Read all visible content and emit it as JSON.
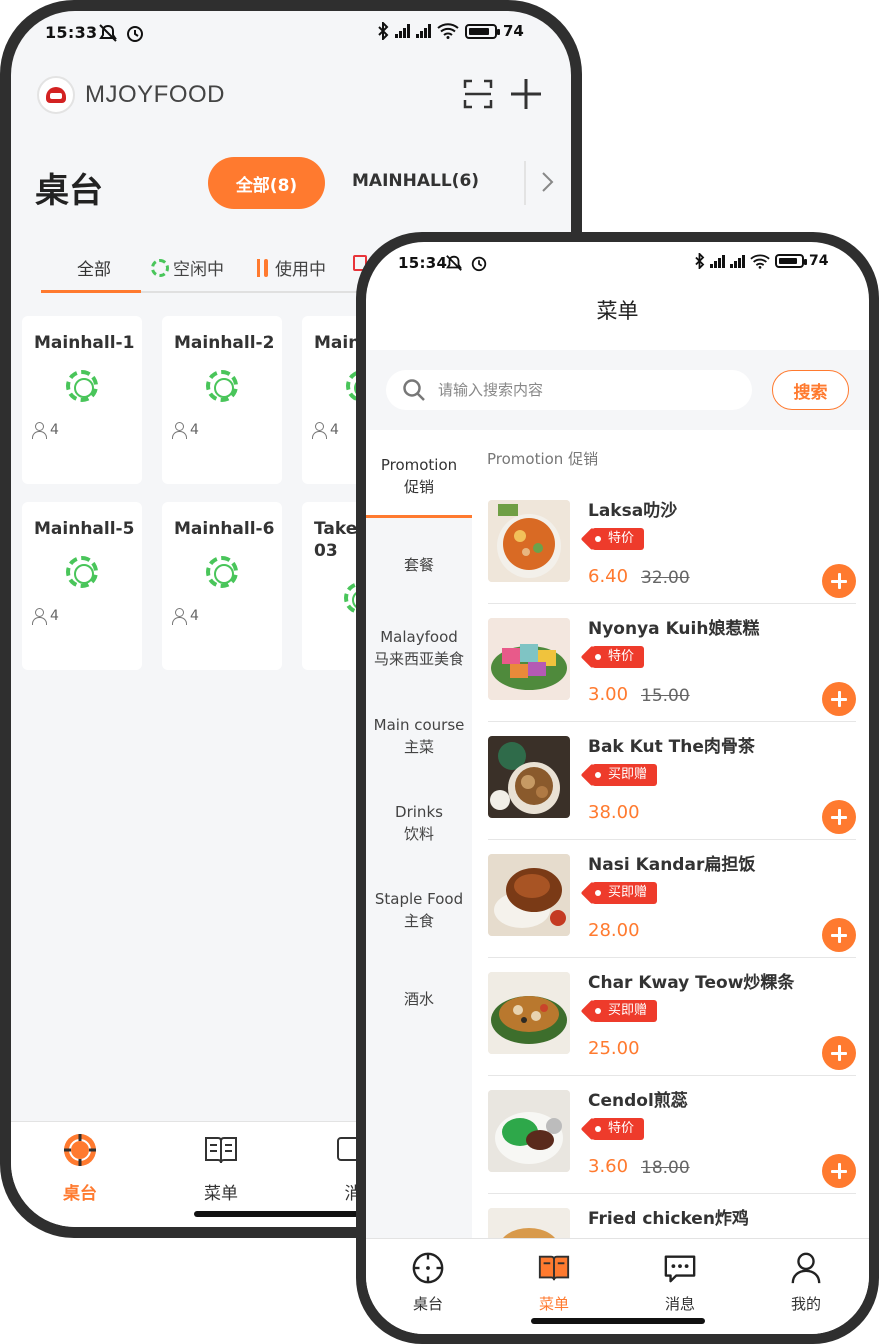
{
  "colors": {
    "accent": "#ff7a2f",
    "idle_green": "#49c55a",
    "tag_red": "#ee3b2b"
  },
  "phone_a": {
    "status": {
      "time": "15:33",
      "battery": "74"
    },
    "brand": "MJOYFOOD",
    "title": "桌台",
    "area_chips": [
      "全部(8)",
      "MAINHALL(6)"
    ],
    "filter_tabs": [
      "全部",
      "空闲中",
      "使用中"
    ],
    "tables": [
      {
        "name": "Mainhall-1",
        "seats": "4"
      },
      {
        "name": "Mainhall-2",
        "seats": "4"
      },
      {
        "name": "Main",
        "seats": "4"
      },
      {
        "name": "Mainhall-5",
        "seats": "4"
      },
      {
        "name": "Mainhall-6",
        "seats": "4"
      },
      {
        "name": "Take-\n03",
        "seats": ""
      }
    ],
    "tabbar": [
      "桌台",
      "菜单",
      "消"
    ]
  },
  "phone_b": {
    "status": {
      "time": "15:34",
      "battery": "74"
    },
    "title": "菜单",
    "search": {
      "placeholder": "请输入搜索内容",
      "button": "搜索"
    },
    "categories": [
      {
        "line1": "Promotion",
        "line2": "促销"
      },
      {
        "line1": "套餐",
        "line2": ""
      },
      {
        "line1": "Malayfood",
        "line2": "马来西亚美食"
      },
      {
        "line1": "Main course",
        "line2": "主菜"
      },
      {
        "line1": "Drinks",
        "line2": "饮料"
      },
      {
        "line1": "Staple Food",
        "line2": "主食"
      },
      {
        "line1": "酒水",
        "line2": ""
      }
    ],
    "section_header": "Promotion   促销",
    "items": [
      {
        "name": "Laksa叻沙",
        "tag": "特价",
        "price": "6.40",
        "old_price": "32.00"
      },
      {
        "name": "Nyonya Kuih娘惹糕",
        "tag": "特价",
        "price": "3.00",
        "old_price": "15.00"
      },
      {
        "name": "Bak Kut The肉骨茶",
        "tag": "买即赠",
        "price": "38.00",
        "old_price": ""
      },
      {
        "name": "Nasi Kandar扁担饭",
        "tag": "买即赠",
        "price": "28.00",
        "old_price": ""
      },
      {
        "name": "Char Kway Teow炒粿条",
        "tag": "买即赠",
        "price": "25.00",
        "old_price": ""
      },
      {
        "name": "Cendol煎蕊",
        "tag": "特价",
        "price": "3.60",
        "old_price": "18.00"
      },
      {
        "name": "Fried chicken炸鸡",
        "tag": "",
        "price": "",
        "old_price": ""
      }
    ],
    "tabbar": [
      "桌台",
      "菜单",
      "消息",
      "我的"
    ]
  }
}
